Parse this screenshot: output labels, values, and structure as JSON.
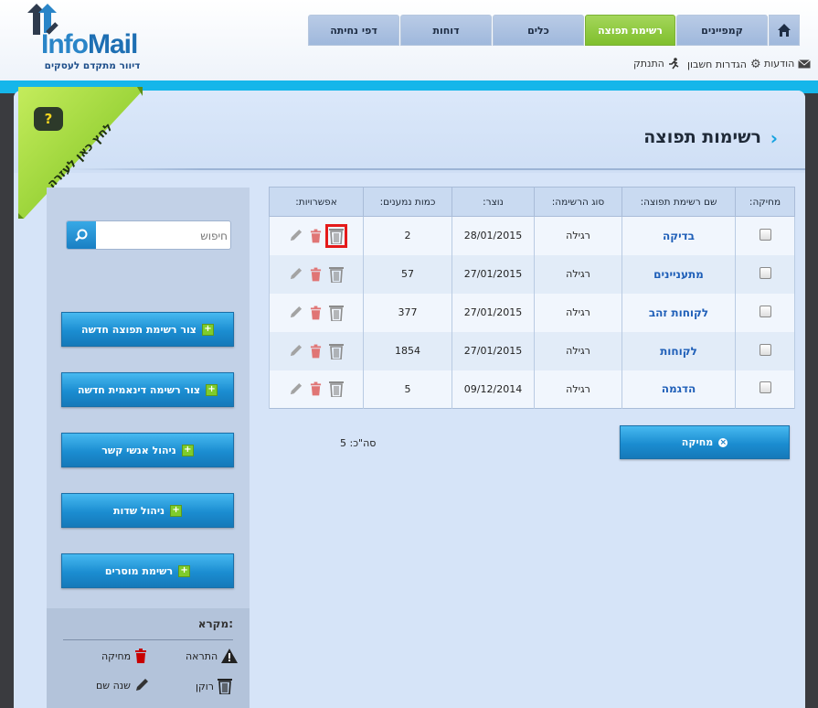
{
  "brand": {
    "name_prefix": "Info",
    "name_suffix": "Mail",
    "tagline": "דיוור מתקדם לעסקים"
  },
  "nav": {
    "tabs": [
      {
        "label": "קמפיינים"
      },
      {
        "label": "רשימת תפוצה"
      },
      {
        "label": "כלים"
      },
      {
        "label": "דוחות"
      },
      {
        "label": "דפי נחיתה"
      }
    ]
  },
  "toplinks": {
    "messages": "הודעות",
    "account_settings": "הגדרות חשבון",
    "logout": "התנתק"
  },
  "help": {
    "label": "לחץ כאן לעזרה"
  },
  "page": {
    "title": "רשימות תפוצה"
  },
  "search": {
    "placeholder": "חיפוש"
  },
  "sidebar": {
    "buttons": [
      {
        "label": "צור רשימת תפוצה חדשה"
      },
      {
        "label": "צור רשימה דינאמית חדשה"
      },
      {
        "label": "ניהול אנשי קשר"
      },
      {
        "label": "ניהול שדות"
      },
      {
        "label": "רשימת מוסרים"
      }
    ]
  },
  "legend": {
    "title": "מקרא:",
    "items": [
      {
        "label": "מחיקה",
        "icon": "trash-red-icon"
      },
      {
        "label": "התראה",
        "icon": "warning-icon"
      },
      {
        "label": "שנה שם",
        "icon": "pencil-icon"
      },
      {
        "label": "רוקן",
        "icon": "empty-bin-icon"
      }
    ]
  },
  "table": {
    "headers": {
      "delete": "מחיקה:",
      "name": "שם רשימת תפוצה:",
      "type": "סוג הרשימה:",
      "created": "נוצר:",
      "count": "כמות נמענים:",
      "options": "אפשרויות:"
    },
    "rows": [
      {
        "name": "בדיקה",
        "type": "רגילה",
        "created": "28/01/2015",
        "count": "2"
      },
      {
        "name": "מתעניינים",
        "type": "רגילה",
        "created": "27/01/2015",
        "count": "57"
      },
      {
        "name": "לקוחות זהב",
        "type": "רגילה",
        "created": "27/01/2015",
        "count": "377"
      },
      {
        "name": "לקוחות",
        "type": "רגילה",
        "created": "27/01/2015",
        "count": "1854"
      },
      {
        "name": "הדגמה",
        "type": "רגילה",
        "created": "09/12/2014",
        "count": "5"
      }
    ]
  },
  "actions": {
    "delete_label": "מחיקה",
    "total": "סה\"כ: 5"
  },
  "colors": {
    "accent_blue": "#1b8dd1",
    "active_tab": "#7fbf2d",
    "cyan_band": "#15b6ea",
    "delete_red": "#d9534f"
  }
}
